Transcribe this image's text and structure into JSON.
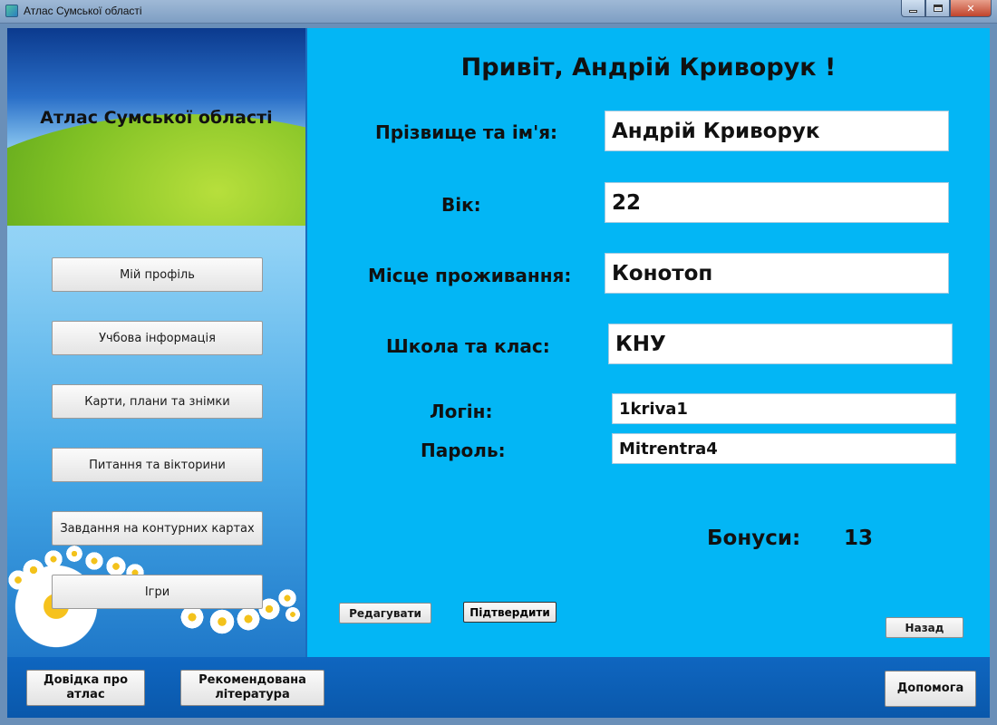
{
  "window": {
    "title": "Атлас Сумської області"
  },
  "sidebar": {
    "banner_title": "Атлас Сумської області",
    "items": [
      {
        "label": "Мій профіль"
      },
      {
        "label": "Учбова інформація"
      },
      {
        "label": "Карти, плани та знімки"
      },
      {
        "label": "Питання та вікторини"
      },
      {
        "label": "Завдання на контурних картах"
      },
      {
        "label": "Ігри"
      }
    ]
  },
  "main": {
    "greeting": "Привіт, Андрій Криворук !",
    "fields": {
      "name": {
        "label": "Прізвище та ім'я:",
        "value": "Андрій Криворук"
      },
      "age": {
        "label": "Вік:",
        "value": "22"
      },
      "city": {
        "label": "Місце проживання:",
        "value": "Конотоп"
      },
      "school": {
        "label": "Школа та клас:",
        "value": "КНУ"
      },
      "login": {
        "label": "Логін:",
        "value": "1kriva1"
      },
      "password": {
        "label": "Пароль:",
        "value": "Mitrentra4"
      }
    },
    "bonus": {
      "label": "Бонуси:",
      "value": "13"
    },
    "buttons": {
      "edit": "Редагувати",
      "confirm": "Підтвердити",
      "back": "Назад"
    }
  },
  "bottom": {
    "about": "Довідка про атлас",
    "literature": "Рекомендована література",
    "help": "Допомога"
  },
  "colors": {
    "main_bg": "#03b6f5",
    "bottom_bar": "#0f66c0"
  }
}
